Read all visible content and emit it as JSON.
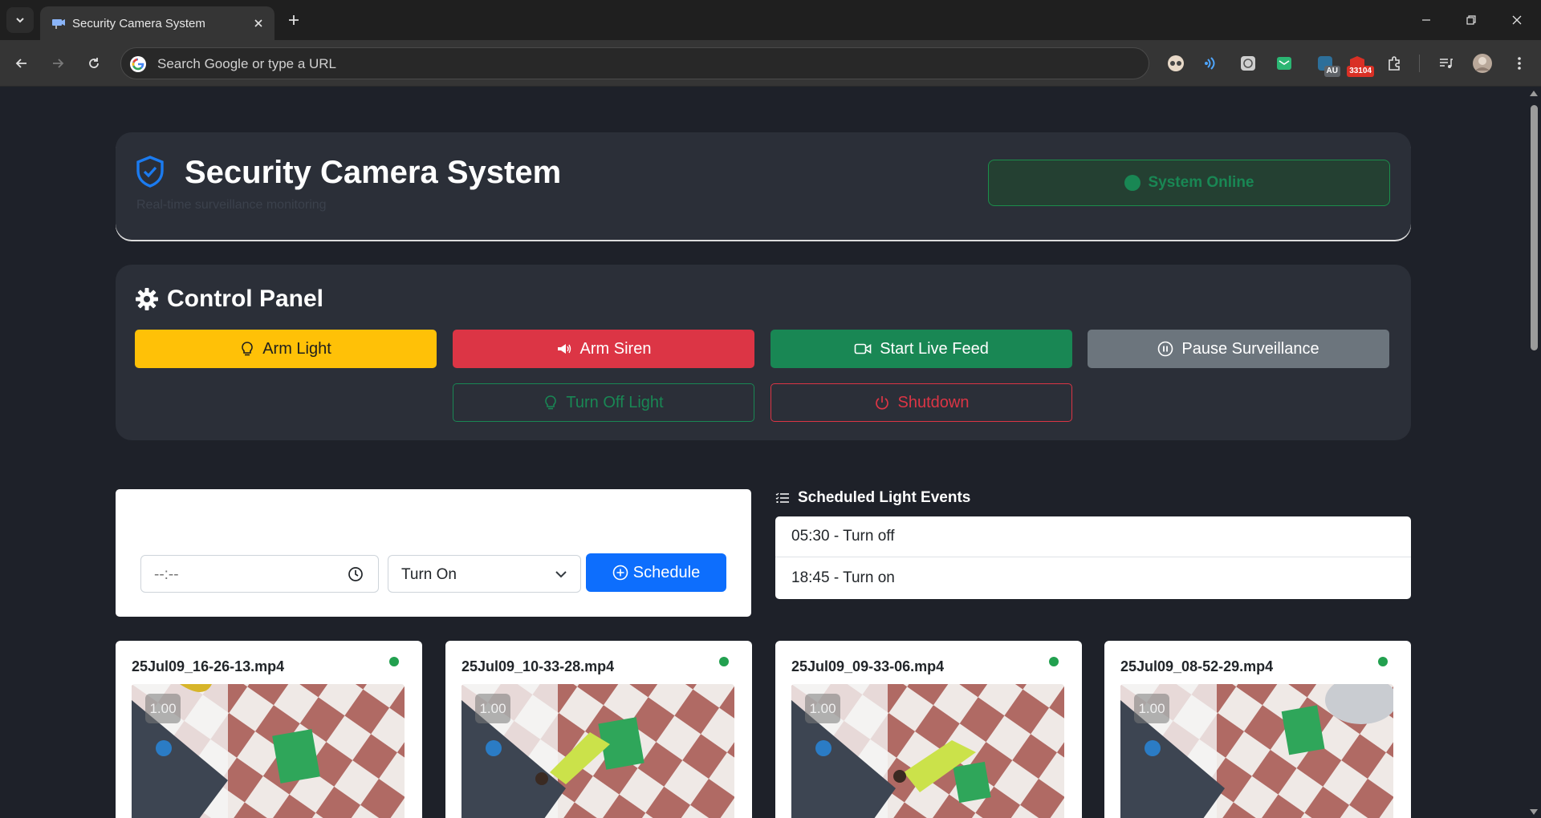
{
  "browser": {
    "tab_title": "Security Camera System",
    "omnibox_placeholder": "Search Google or type a URL",
    "extension_badge": "33104",
    "extension_au_label": "AU"
  },
  "header": {
    "title": "Security Camera System",
    "subtitle": "Real-time surveillance monitoring",
    "status": "System Online"
  },
  "control_panel": {
    "title": "Control Panel",
    "buttons": {
      "arm_light": "Arm Light",
      "arm_siren": "Arm Siren",
      "start_live_feed": "Start Live Feed",
      "pause_surveillance": "Pause Surveillance",
      "turn_off_light": "Turn Off Light",
      "shutdown": "Shutdown"
    }
  },
  "schedule": {
    "time_value": "--:--",
    "action_selected": "Turn On",
    "button": "Schedule"
  },
  "events": {
    "title": "Scheduled Light Events",
    "items": [
      "05:30 - Turn off",
      "18:45 - Turn on"
    ]
  },
  "videos": [
    {
      "name": "25Jul09_16-26-13.mp4",
      "speed": "1.00"
    },
    {
      "name": "25Jul09_10-33-28.mp4",
      "speed": "1.00"
    },
    {
      "name": "25Jul09_09-33-06.mp4",
      "speed": "1.00"
    },
    {
      "name": "25Jul09_08-52-29.mp4",
      "speed": "1.00"
    }
  ],
  "colors": {
    "warning": "#ffc107",
    "danger": "#dc3545",
    "success": "#198754",
    "secondary": "#6c757d",
    "primary": "#0d6efd",
    "card_dark": "#2b2f38"
  }
}
